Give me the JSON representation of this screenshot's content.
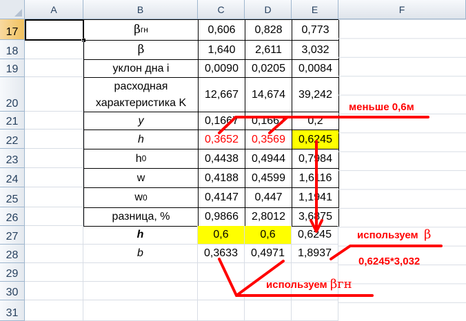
{
  "columns": [
    "A",
    "B",
    "C",
    "D",
    "E",
    "F"
  ],
  "rows": [
    "17",
    "18",
    "19",
    "20",
    "21",
    "22",
    "23",
    "24",
    "25",
    "26",
    "27",
    "28",
    "29",
    "30",
    "31"
  ],
  "table": [
    {
      "label_pre": "β",
      "label_sub": "гн",
      "c": "0,606",
      "d": "0,828",
      "e": "0,773"
    },
    {
      "label": "β",
      "c": "1,640",
      "d": "2,611",
      "e": "3,032"
    },
    {
      "label_pre": "уклон дна ",
      "label_it": "i",
      "c": "0,0090",
      "d": "0,0205",
      "e": "0,0084"
    },
    {
      "label_pre": "расходная характеристика ",
      "label_it": "K",
      "c": "12,667",
      "d": "14,674",
      "e": "39,242"
    },
    {
      "label": "y",
      "c": "0,1667",
      "d": "0,1667",
      "e": "0,2"
    },
    {
      "label": "h",
      "c": "0,3652",
      "d": "0,3569",
      "e": "0,6245"
    },
    {
      "label_pre": "h ",
      "label_sub": "0",
      "c": "0,4438",
      "d": "0,4944",
      "e": "0,7984"
    },
    {
      "label": "w",
      "c": "0,4188",
      "d": "0,4599",
      "e": "1,6116"
    },
    {
      "label_pre": "w",
      "label_sub": "0",
      "c": "0,4147",
      "d": "0,447",
      "e": "1,1941"
    },
    {
      "label": "разница, %",
      "c": "0,9866",
      "d": "2,8012",
      "e": "3,6875"
    },
    {
      "label": "h",
      "c": "0,6",
      "d": "0,6",
      "e": "0,6245"
    },
    {
      "label": "b",
      "c": "0,3633",
      "d": "0,4971",
      "e": "1,8937"
    }
  ],
  "notes": {
    "less": "меньше 0,6м",
    "use_beta": "используем",
    "use_beta_symbol": "β",
    "formula": "0,6245*3,032",
    "use_beta_gn": "используем",
    "use_beta_gn_symbol": "βгн"
  },
  "colors": {
    "highlight": "#ffff00",
    "annotation": "#ff0000",
    "header_selected": "#f1c15f",
    "grid": "#d8dde5"
  }
}
